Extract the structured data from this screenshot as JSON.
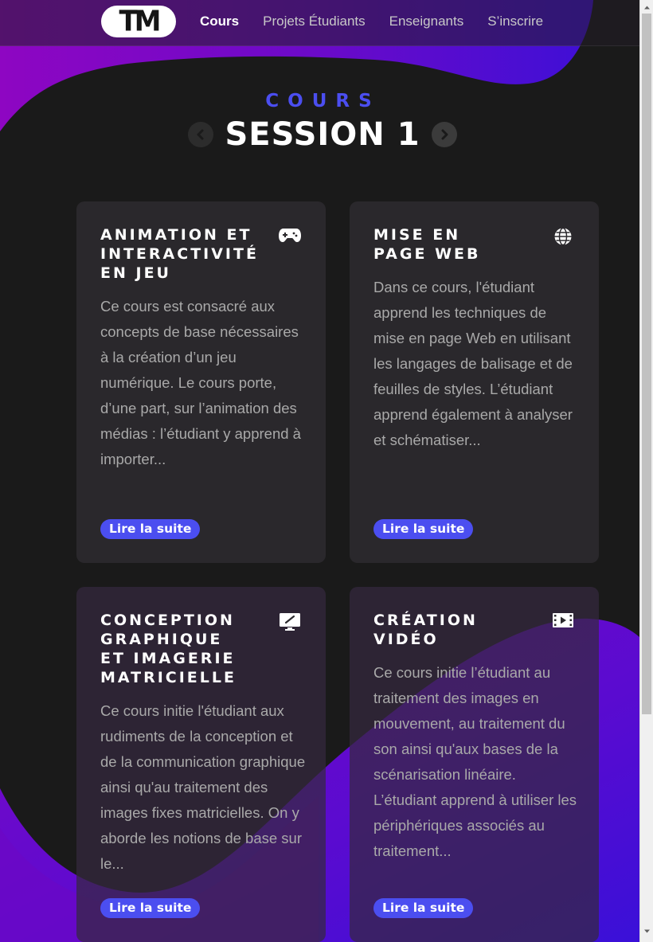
{
  "nav": {
    "logo_text": "TM",
    "links": [
      {
        "label": "Cours",
        "active": true
      },
      {
        "label": "Projets Étudiants",
        "active": false
      },
      {
        "label": "Enseignants",
        "active": false
      },
      {
        "label": "S’inscrire",
        "active": false
      }
    ]
  },
  "header": {
    "eyebrow": "COURS",
    "session_title": "SESSION 1",
    "prev_icon": "chevron-left-icon",
    "next_icon": "chevron-right-icon"
  },
  "cards": [
    {
      "title": "ANIMATION ET\nINTERACTIVITÉ\nEN JEU",
      "icon": "gamepad-icon",
      "description": "Ce cours est consacré aux concepts de base nécessaires à la création d’un jeu numérique. Le cours porte, d’une part, sur l’animation des médias : l’étudiant y apprend à importer...",
      "link_label": "Lire la suite"
    },
    {
      "title": "MISE EN\nPAGE WEB",
      "icon": "globe-icon",
      "description": "Dans ce cours, l'étudiant apprend les techniques de mise en page Web en utilisant les langages de balisage et de feuilles de styles. L’étudiant apprend également à analyser et schématiser...",
      "link_label": "Lire la suite"
    },
    {
      "title": "CONCEPTION\nGRAPHIQUE\nET IMAGERIE\nMATRICIELLE",
      "icon": "drawing-tablet-icon",
      "description": "Ce cours initie l'étudiant aux rudiments de la conception et de la communication graphique ainsi qu'au traitement des images fixes matricielles. On y aborde les notions de base sur le...",
      "link_label": "Lire la suite"
    },
    {
      "title": "CRÉATION\nVIDÉO",
      "icon": "film-icon",
      "description": "Ce cours initie l’étudiant au traitement des images en mouvement, au traitement du son ainsi qu'aux bases de la scénarisation linéaire. L’étudiant apprend à utiliser les périphériques associés au traitement...",
      "link_label": "Lire la suite"
    }
  ],
  "colors": {
    "accent": "#4b4ef0",
    "background": "#1a1a1a",
    "card": "#2c2a2e",
    "purple": "#8a07c4",
    "indigo": "#3f0fd6"
  }
}
